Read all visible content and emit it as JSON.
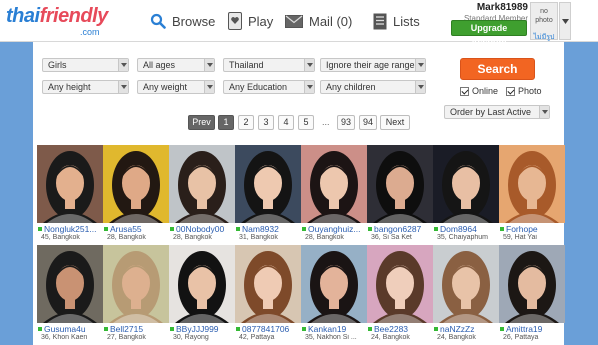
{
  "header": {
    "logo_main_a": "thai",
    "logo_main_b": "friendly",
    "logo_sub": ".com",
    "nav": {
      "browse": "Browse",
      "play": "Play",
      "mail": "Mail (0)",
      "lists": "Lists"
    },
    "user": {
      "username": "Mark81989",
      "member_type": "Standard Member",
      "upgrade_label": "Upgrade Account",
      "no_photo_line1": "no",
      "no_photo_line2": "photo",
      "no_photo_thai": "ไม่มีรูป"
    }
  },
  "filters": {
    "row1": [
      "Girls",
      "All ages",
      "Thailand",
      "Ignore their age range"
    ],
    "row2": [
      "Any height",
      "Any weight",
      "Any Education",
      "Any children"
    ],
    "search_label": "Search",
    "online_label": "Online",
    "photo_label": "Photo",
    "order_by": "Order by Last Active"
  },
  "pagination": {
    "prev": "Prev",
    "pages": [
      "1",
      "2",
      "3",
      "4",
      "5"
    ],
    "dots": "...",
    "last_pages": [
      "93",
      "94"
    ],
    "next": "Next",
    "current": "1"
  },
  "profiles": [
    {
      "name": "Nongluk251...",
      "info": "45, Bangkok",
      "bg": "#7e5a4a",
      "skin": "#e3b08e",
      "hair": "#1a1a1a"
    },
    {
      "name": "Arusa55",
      "info": "28, Bangkok",
      "bg": "#e0b82e",
      "skin": "#dfa987",
      "hair": "#221812"
    },
    {
      "name": "00Nobody00",
      "info": "28, Bangkok",
      "bg": "#bfc4c8",
      "skin": "#e8c2a6",
      "hair": "#2a1f1a"
    },
    {
      "name": "Nam8932",
      "info": "31, Bangkok",
      "bg": "#3c4a5e",
      "skin": "#eec9b0",
      "hair": "#141414"
    },
    {
      "name": "Ouyanghuiz...",
      "info": "28, Bangkok",
      "bg": "#cc8f88",
      "skin": "#edc7ae",
      "hair": "#1c1414"
    },
    {
      "name": "bangon6287",
      "info": "36, Si Sa Ket",
      "bg": "#2e2e36",
      "skin": "#dcab90",
      "hair": "#0e0e0e"
    },
    {
      "name": "Dom8964",
      "info": "35, Chaiyaphum",
      "bg": "#1a1c26",
      "skin": "#e8bfa4",
      "hair": "#151515"
    },
    {
      "name": "Forhope",
      "info": "59, Hat Yai",
      "bg": "#e6a670",
      "skin": "#e7b793",
      "hair": "#a85a2a"
    },
    {
      "name": "Gusuma4u",
      "info": "36, Khon Kaen",
      "bg": "#6f6a60",
      "skin": "#c99273",
      "hair": "#1a1a1a"
    },
    {
      "name": "Bell2715",
      "info": "27, Bangkok",
      "bg": "#c7c49c",
      "skin": "#ddb08f",
      "hair": "#b79b74"
    },
    {
      "name": "BByJJJ999",
      "info": "30, Rayong",
      "bg": "#e6e3e0",
      "skin": "#e9c2a7",
      "hair": "#121212"
    },
    {
      "name": "0877841706",
      "info": "42, Pattaya",
      "bg": "#d7c6b2",
      "skin": "#efcbb4",
      "hair": "#7e4a2a"
    },
    {
      "name": "Kankan19",
      "info": "35, Nakhon Si ...",
      "bg": "#96b0c6",
      "skin": "#e3b39a",
      "hair": "#1a1414"
    },
    {
      "name": "Bee2283",
      "info": "24, Bangkok",
      "bg": "#d7a6bf",
      "skin": "#efcebb",
      "hair": "#5a3a2a"
    },
    {
      "name": "naNZzZz",
      "info": "24, Bangkok",
      "bg": "#c9cdd0",
      "skin": "#e8c3a8",
      "hair": "#8a6042"
    },
    {
      "name": "Amittra19",
      "info": "26, Pattaya",
      "bg": "#9ea8b6",
      "skin": "#e4bba0",
      "hair": "#1c1714"
    }
  ]
}
